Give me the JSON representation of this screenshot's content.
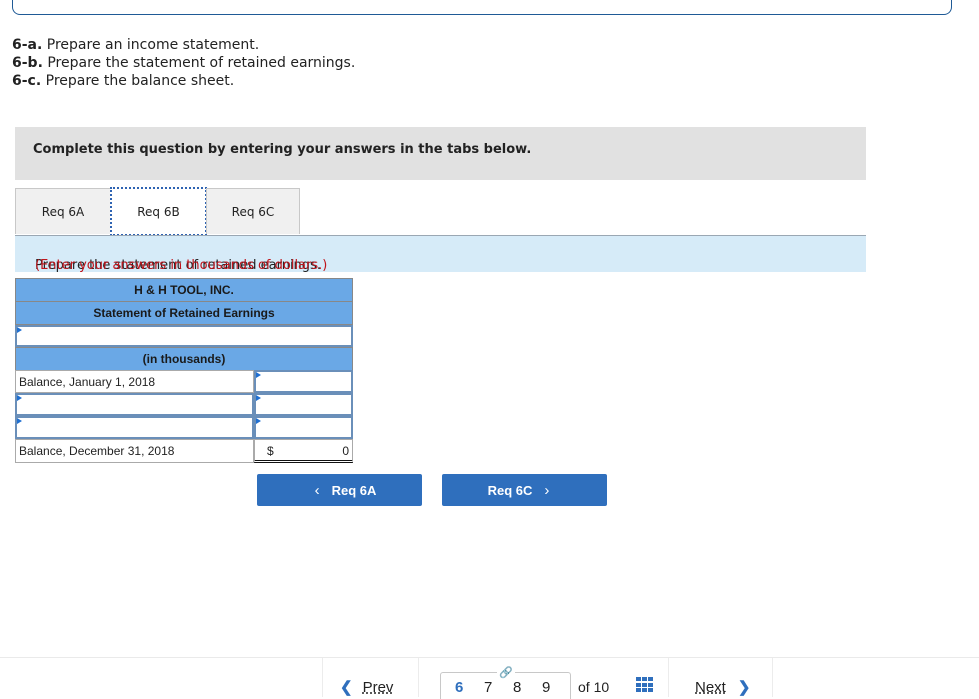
{
  "instructions": [
    {
      "label": "6-a.",
      "text": " Prepare an income statement."
    },
    {
      "label": "6-b.",
      "text": " Prepare the statement of retained earnings."
    },
    {
      "label": "6-c.",
      "text": " Prepare the balance sheet."
    }
  ],
  "banner": "Complete this question by entering your answers in the tabs below.",
  "tabs": [
    {
      "label": "Req 6A"
    },
    {
      "label": "Req 6B",
      "active": true
    },
    {
      "label": "Req 6C"
    }
  ],
  "prompt": {
    "text": "Prepare the statement of retained earnings.",
    "note": "(Enter your answers in thousands of dollars.)"
  },
  "statement": {
    "company": "H & H TOOL, INC.",
    "title": "Statement of Retained Earnings",
    "period_input": "",
    "units": "(in thousands)",
    "rows": [
      {
        "label": "Balance, January 1, 2018",
        "value": ""
      },
      {
        "label": "",
        "value": ""
      },
      {
        "label": "",
        "value": ""
      }
    ],
    "total": {
      "label": "Balance, December 31, 2018",
      "currency": "$",
      "value": "0"
    }
  },
  "nav_buttons": {
    "prev": "Req 6A",
    "next": "Req 6C"
  },
  "footer": {
    "prev": "Prev",
    "pages": [
      "6",
      "7",
      "8",
      "9"
    ],
    "current_page": "6",
    "of_text": "of 10",
    "next": "Next"
  }
}
